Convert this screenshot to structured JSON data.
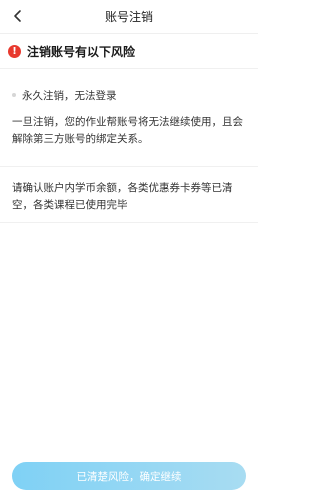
{
  "header": {
    "title": "账号注销",
    "back_icon": "chevron-left-icon"
  },
  "risk": {
    "icon": "exclamation-circle-icon",
    "icon_glyph": "!",
    "icon_color": "#e8392e",
    "title": "注销账号有以下风险"
  },
  "section1": {
    "bullet": "永久注销，无法登录",
    "paragraph": "一旦注销，您的作业帮账号将无法继续使用，且会解除第三方账号的绑定关系。"
  },
  "section2": {
    "paragraph": "请确认账户内学币余额，各类优惠券卡券等已清空，各类课程已使用完毕"
  },
  "footer": {
    "confirm_label": "已清楚风险，确定继续",
    "button_color_start": "#7fd1f5",
    "button_color_end": "#a8dcf2"
  }
}
